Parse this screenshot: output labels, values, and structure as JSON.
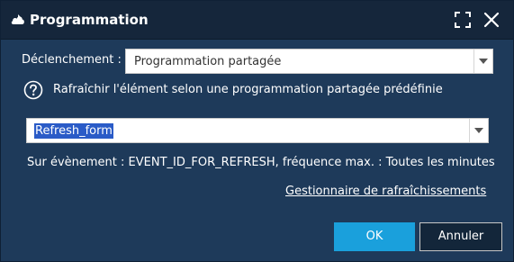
{
  "window": {
    "title": "Programmation",
    "icons": {
      "app": "cloud-icon",
      "maximize": "maximize-icon",
      "close": "close-icon"
    }
  },
  "trigger": {
    "label": "Déclenchement :",
    "selected": "Programmation partagée"
  },
  "help": {
    "icon": "help-icon",
    "text": "Rafraîchir l'élément selon une programmation partagée prédéfinie"
  },
  "schedule": {
    "selected": "Refresh_form"
  },
  "event_line": "Sur évènement : EVENT_ID_FOR_REFRESH, fréquence max. : Toutes les minutes",
  "links": {
    "refresh_manager": "Gestionnaire de rafraîchissements"
  },
  "buttons": {
    "ok": "OK",
    "cancel": "Annuler"
  },
  "colors": {
    "dialog_background": "#1e3a5a",
    "titlebar_background": "#15263b",
    "ok_button": "#1aa0dc",
    "selection_highlight": "#2a5bc7"
  }
}
